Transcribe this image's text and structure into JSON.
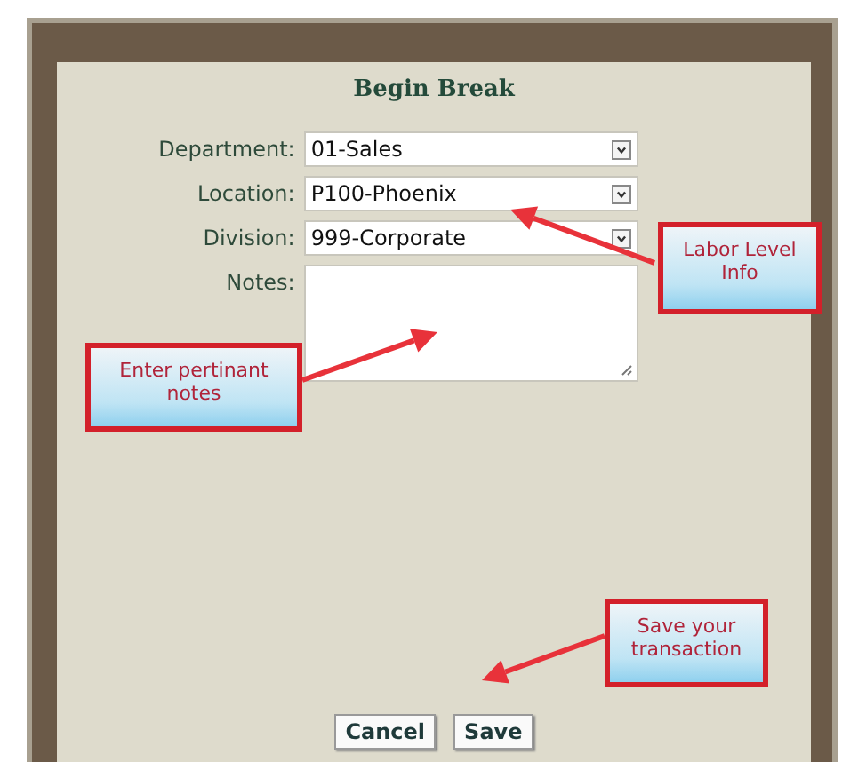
{
  "dialog": {
    "title": "Begin Break",
    "fields": [
      {
        "kind": "select",
        "label": "Department:",
        "value": "01-Sales"
      },
      {
        "kind": "select",
        "label": "Location:",
        "value": "P100-Phoenix"
      },
      {
        "kind": "select",
        "label": "Division:",
        "value": "999-Corporate"
      },
      {
        "kind": "textarea",
        "label": "Notes:"
      }
    ],
    "buttons": [
      "Cancel",
      "Save"
    ]
  },
  "callouts": [
    {
      "text": "Labor Level Info"
    },
    {
      "text": "Enter pertinant notes"
    },
    {
      "text": "Save your transaction"
    }
  ]
}
